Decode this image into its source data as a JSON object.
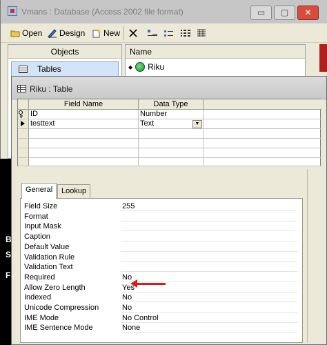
{
  "db_window": {
    "title": "Vmans : Database (Access 2002 file format)",
    "controls": {
      "minimize": "▭",
      "maximize": "▢",
      "close": "✕"
    },
    "toolbar": {
      "open": "Open",
      "design": "Design",
      "new": "New"
    },
    "objects_header": "Objects",
    "tables_label": "Tables",
    "name_header": "Name",
    "name_item": "Riku"
  },
  "desktop_letters": [
    "B",
    "S",
    "F"
  ],
  "table_window": {
    "title": "Riku : Table",
    "columns": {
      "field_name": "Field Name",
      "data_type": "Data Type"
    },
    "rows": [
      {
        "name": "ID",
        "type": "Number",
        "key": true
      },
      {
        "name": "testtext",
        "type": "Text",
        "current": true
      }
    ],
    "tabs": {
      "general": "General",
      "lookup": "Lookup"
    },
    "properties": [
      {
        "label": "Field Size",
        "value": "255"
      },
      {
        "label": "Format",
        "value": ""
      },
      {
        "label": "Input Mask",
        "value": ""
      },
      {
        "label": "Caption",
        "value": ""
      },
      {
        "label": "Default Value",
        "value": ""
      },
      {
        "label": "Validation Rule",
        "value": ""
      },
      {
        "label": "Validation Text",
        "value": ""
      },
      {
        "label": "Required",
        "value": "No"
      },
      {
        "label": "Allow Zero Length",
        "value": "Yes"
      },
      {
        "label": "Indexed",
        "value": "No"
      },
      {
        "label": "Unicode Compression",
        "value": "No"
      },
      {
        "label": "IME Mode",
        "value": "No Control"
      },
      {
        "label": "IME Sentence Mode",
        "value": "None"
      }
    ]
  },
  "colors": {
    "annotation_arrow": "#e01818",
    "selection": "#d4e4f8"
  }
}
